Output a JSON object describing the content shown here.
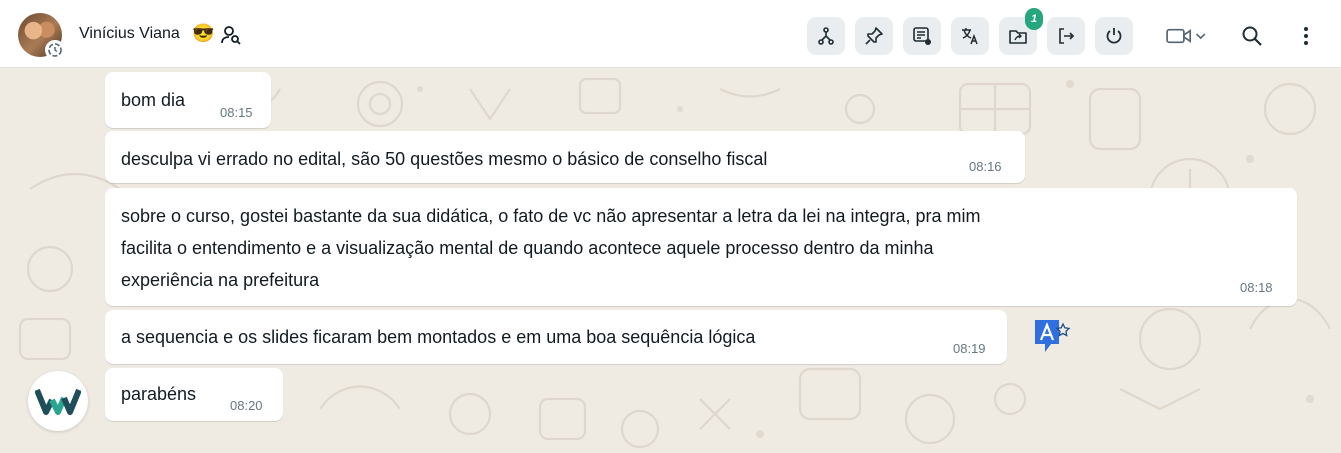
{
  "header": {
    "contact_name": "Vinícius Viana",
    "emoji": "😎",
    "tools": [
      {
        "icon": "fork-icon"
      },
      {
        "icon": "pin-icon"
      },
      {
        "icon": "message-edit-icon"
      },
      {
        "icon": "translate-icon"
      },
      {
        "icon": "folder-share-icon",
        "badge": "1"
      },
      {
        "icon": "logout-icon"
      },
      {
        "icon": "power-icon"
      }
    ],
    "video_icon": "video-call-icon",
    "search_icon": "search-icon",
    "menu_icon": "more-vertical-icon"
  },
  "messages": [
    {
      "text": "bom dia",
      "time": "08:15"
    },
    {
      "text": "desculpa vi errado no edital, são 50 questões mesmo o básico de conselho fiscal",
      "time": "08:16"
    },
    {
      "lines": [
        "sobre o curso, gostei bastante da sua didática, o fato de vc não apresentar a letra da lei na integra, pra mim",
        "facilita o entendimento e a visualização mental de quando acontece aquele processo dentro da minha",
        "experiência na prefeitura"
      ],
      "time": "08:18"
    },
    {
      "text": "a sequencia e os slides ficaram bem montados e em uma boa sequência lógica",
      "time": "08:19"
    },
    {
      "text": "parabéns",
      "time": "08:20"
    }
  ],
  "colors": {
    "chat_background": "#efeae2",
    "bubble": "#ffffff",
    "badge": "#25a67c",
    "timestamp": "#667781",
    "logo_dark": "#1f4e5a",
    "logo_teal": "#2aa58f"
  }
}
